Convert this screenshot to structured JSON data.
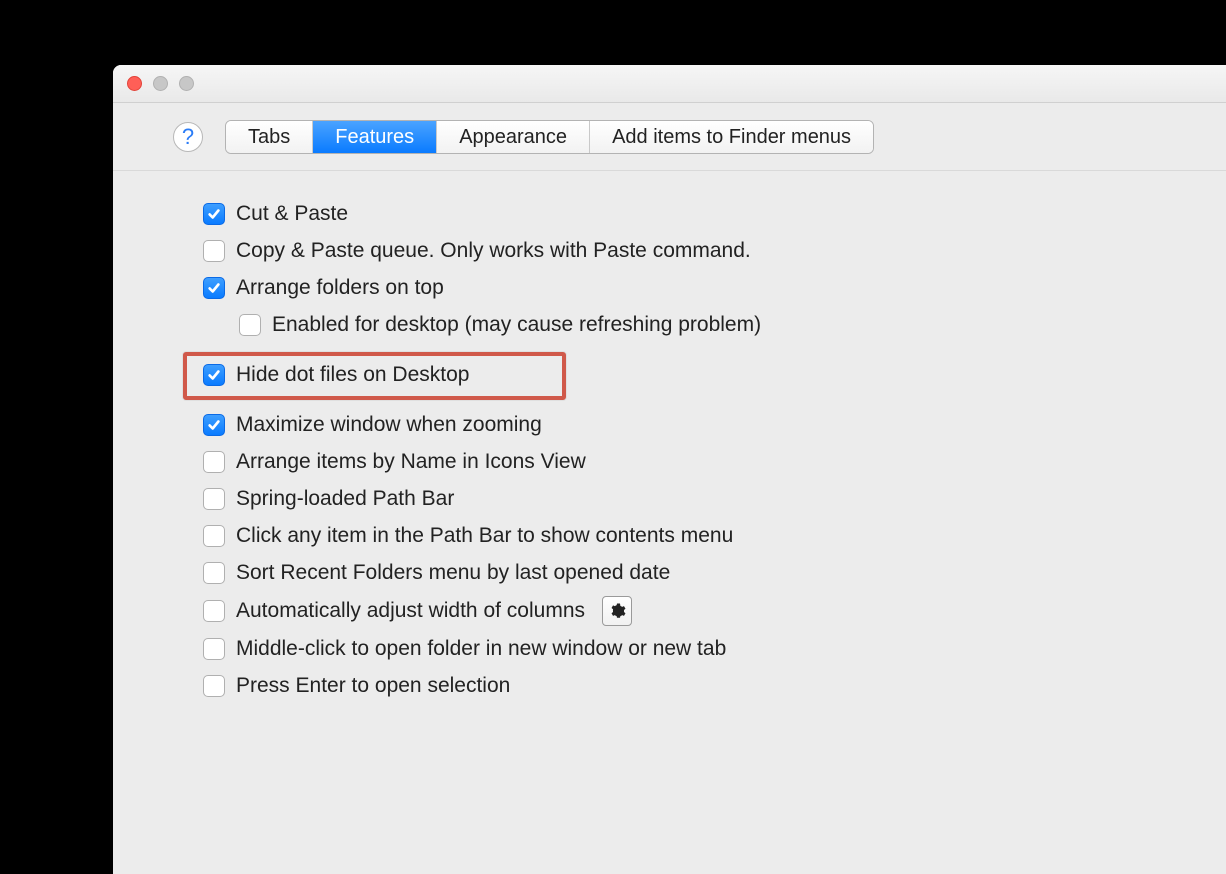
{
  "window": {
    "traffic": {
      "close": "close",
      "minimize": "minimize",
      "zoom": "zoom"
    }
  },
  "toolbar": {
    "help_label": "?",
    "tabs": [
      {
        "label": "Tabs",
        "active": false
      },
      {
        "label": "Features",
        "active": true
      },
      {
        "label": "Appearance",
        "active": false
      },
      {
        "label": "Add items to Finder menus",
        "active": false
      }
    ]
  },
  "options": [
    {
      "label": "Cut & Paste",
      "checked": true,
      "indent": false
    },
    {
      "label": "Copy & Paste queue. Only works with Paste command.",
      "checked": false,
      "indent": false
    },
    {
      "label": "Arrange folders on top",
      "checked": true,
      "indent": false
    },
    {
      "label": "Enabled for desktop (may cause refreshing problem)",
      "checked": false,
      "indent": true
    },
    {
      "label": "Hide dot files on Desktop",
      "checked": true,
      "indent": false,
      "highlighted": true
    },
    {
      "label": "Maximize window when zooming",
      "checked": true,
      "indent": false
    },
    {
      "label": "Arrange items by Name in Icons View",
      "checked": false,
      "indent": false
    },
    {
      "label": "Spring-loaded Path Bar",
      "checked": false,
      "indent": false
    },
    {
      "label": "Click any item in the Path Bar to show contents menu",
      "checked": false,
      "indent": false
    },
    {
      "label": "Sort Recent Folders menu by last opened date",
      "checked": false,
      "indent": false
    },
    {
      "label": "Automatically adjust width of columns",
      "checked": false,
      "indent": false,
      "gear": true
    },
    {
      "label": "Middle-click to open folder in new window or new tab",
      "checked": false,
      "indent": false
    },
    {
      "label": "Press Enter to open selection",
      "checked": false,
      "indent": false
    }
  ]
}
